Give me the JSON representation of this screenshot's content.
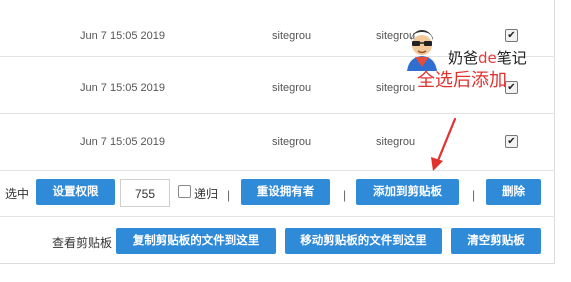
{
  "rows": [
    {
      "date": "Jun 7 15:05 2019",
      "owner": "sitegrou",
      "group": "sitegrou",
      "checked": true
    },
    {
      "date": "Jun 7 15:05 2019",
      "owner": "sitegrou",
      "group": "sitegrou",
      "checked": true
    },
    {
      "date": "Jun 7 15:05 2019",
      "owner": "sitegrou",
      "group": "sitegrou",
      "checked": true
    }
  ],
  "selection_bar": {
    "prefix": "选中",
    "set_permission_label": "设置权限",
    "permission_value": "755",
    "recursive_label": "递归",
    "separator": "|",
    "reset_owner_label": "重设拥有者",
    "add_to_clipboard_label": "添加到剪贴板",
    "delete_label": "删除"
  },
  "clipboard_bar": {
    "label": "查看剪贴板",
    "copy_here_label": "复制剪贴板的文件到这里",
    "move_here_label": "移动剪贴板的文件到这里",
    "clear_label": "清空剪贴板"
  },
  "overlay": {
    "name_prefix": "奶爸",
    "name_highlight": "de",
    "name_suffix": "笔记",
    "caption": "全选后添加",
    "arrow_color": "#e0322f"
  },
  "colors": {
    "primary_button": "#2f8ad8",
    "annotation": "#e0322f"
  }
}
